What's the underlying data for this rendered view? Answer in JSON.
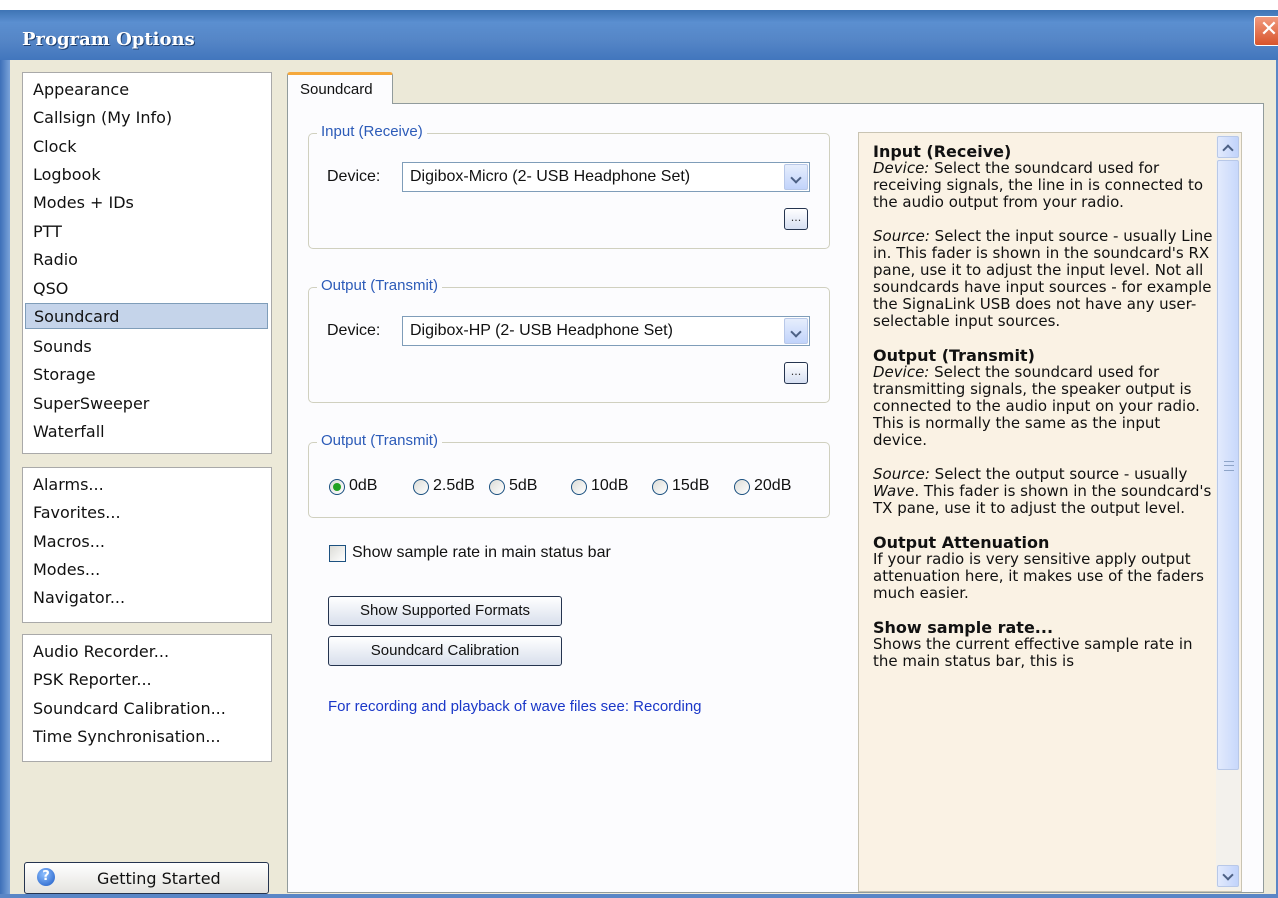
{
  "window": {
    "title": "Program Options",
    "close_glyph": "✕"
  },
  "sidebar": {
    "group1": [
      "Appearance",
      "Callsign (My Info)",
      "Clock",
      "Logbook",
      "Modes + IDs",
      "PTT",
      "Radio",
      "QSO",
      "Soundcard",
      "Sounds",
      "Storage",
      "SuperSweeper",
      "Waterfall"
    ],
    "selected": "Soundcard",
    "group2": [
      "Alarms...",
      "Favorites...",
      "Macros...",
      "Modes...",
      "Navigator..."
    ],
    "group3": [
      "Audio Recorder...",
      "PSK Reporter...",
      "Soundcard Calibration...",
      "Time Synchronisation..."
    ],
    "getting_started": "Getting Started",
    "help_icon": "question-icon"
  },
  "tab": {
    "label": "Soundcard"
  },
  "input_group": {
    "title": "Input (Receive)",
    "device_label": "Device:",
    "device_value": "Digibox-Micro (2- USB Headphone Set)",
    "browse_label": "..."
  },
  "output_group": {
    "title": "Output (Transmit)",
    "device_label": "Device:",
    "device_value": "Digibox-HP (2- USB Headphone Set)",
    "browse_label": "..."
  },
  "attenuation_group": {
    "title": "Output (Transmit)",
    "options": [
      "0dB",
      "2.5dB",
      "5dB",
      "10dB",
      "15dB",
      "20dB"
    ],
    "selected": "0dB"
  },
  "sample_rate_checkbox": {
    "label": "Show sample rate in main status bar",
    "checked": false
  },
  "buttons": {
    "formats": "Show Supported Formats",
    "calibration": "Soundcard Calibration"
  },
  "recording_link": "For recording and playback of wave files see: Recording",
  "help": {
    "input_heading": "Input (Receive)",
    "input_device_term": "Device:",
    "input_device_text": " Select the soundcard used for receiving signals, the line in is connected to the audio output from your radio.",
    "input_source_term": "Source:",
    "input_source_text": " Select the input source - usually Line in. This fader is shown in the soundcard's RX pane, use it to adjust the input level. Not all soundcards have input sources - for example the SignaLink USB does not have any user-selectable input sources.",
    "output_heading": "Output (Transmit)",
    "output_device_term": "Device:",
    "output_device_text": " Select the soundcard used for transmitting signals, the speaker output is connected to the audio input on your radio. This is normally the same as the input device.",
    "output_source_term": "Source:",
    "output_source_text_a": " Select the output source - usually ",
    "output_source_wave": "Wave",
    "output_source_text_b": ". This fader is shown in the soundcard's TX pane, use it to adjust the output level.",
    "atten_heading": "Output Attenuation",
    "atten_text": "If your radio is very sensitive apply output attenuation here, it makes use of the faders much easier.",
    "samplerate_heading": "Show sample rate...",
    "samplerate_text": "Shows the current effective sample rate in the main status bar, this is"
  }
}
